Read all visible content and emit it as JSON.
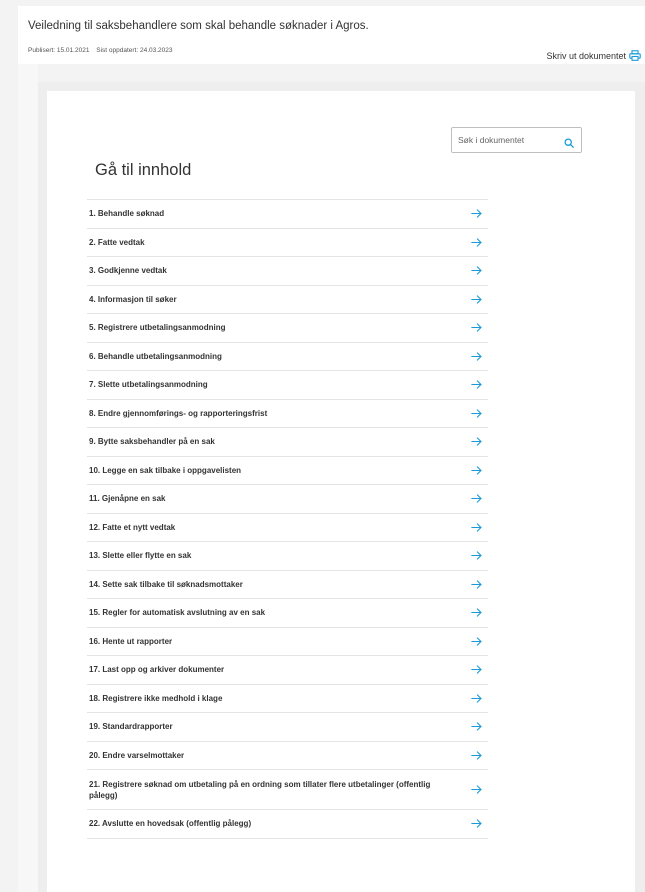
{
  "header": {
    "intro": "Veiledning til saksbehandlere som skal behandle søknader i Agros.",
    "published": "Publisert: 15.01.2021",
    "updated": "Sist oppdatert: 24.03.2023",
    "print_label": "Skriv ut dokumentet"
  },
  "search": {
    "placeholder": "Søk i dokumentet",
    "value": ""
  },
  "toc": {
    "title": "Gå til innhold",
    "items": [
      "1. Behandle søknad",
      "2. Fatte vedtak",
      "3. Godkjenne vedtak",
      "4. Informasjon til søker",
      "5. Registrere utbetalingsanmodning",
      "6. Behandle utbetalingsanmodning",
      "7. Slette utbetalingsanmodning",
      "8. Endre gjennomførings- og rapporteringsfrist",
      "9. Bytte saksbehandler på en sak",
      "10. Legge en sak tilbake i oppgavelisten",
      "11. Gjenåpne en sak",
      "12. Fatte et nytt vedtak",
      "13. Slette eller flytte en sak",
      "14. Sette sak tilbake til søknadsmottaker",
      "15. Regler for automatisk avslutning av en sak",
      "16. Hente ut rapporter",
      "17. Last opp og arkiver dokumenter",
      "18. Registrere ikke medhold i klage",
      "19. Standardrapporter",
      "20. Endre varselmottaker",
      "21. Registrere søknad om utbetaling på en ordning som tillater flere utbetalinger (offentlig pålegg)",
      "22. Avslutte en hovedsak (offentlig pålegg)"
    ]
  },
  "colors": {
    "accent": "#1a9ad6",
    "text": "#333333",
    "divider": "#e4e4e4"
  },
  "icons": {
    "print": "printer-icon",
    "search": "search-icon",
    "row_arrow": "arrow-right-icon"
  }
}
